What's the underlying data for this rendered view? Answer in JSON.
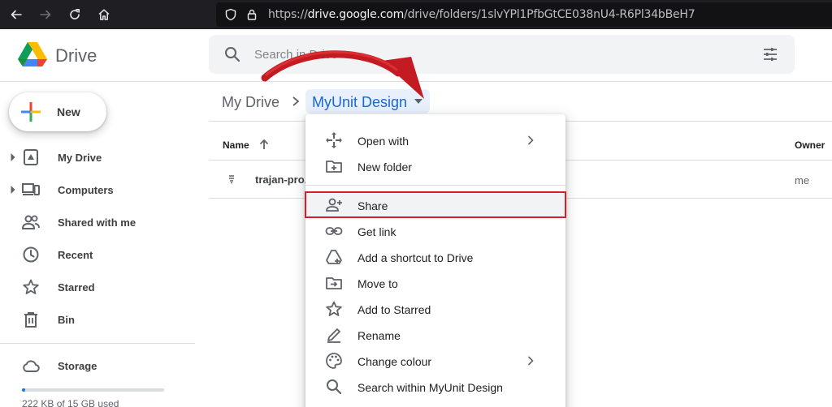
{
  "browser": {
    "url_host_prefix": "https://",
    "url_host": "drive.google.com",
    "url_path": "/drive/folders/1slvYPl1PfbGtCE038nU4-R6Pl34bBeH7"
  },
  "header": {
    "app_name": "Drive",
    "search_placeholder": "Search in Drive"
  },
  "sidebar": {
    "new_label": "New",
    "items": [
      {
        "label": "My Drive"
      },
      {
        "label": "Computers"
      },
      {
        "label": "Shared with me"
      },
      {
        "label": "Recent"
      },
      {
        "label": "Starred"
      },
      {
        "label": "Bin"
      }
    ],
    "storage_label": "Storage",
    "storage_used_text": "222 KB of 15 GB used",
    "storage_used_fraction": 0.01
  },
  "main": {
    "breadcrumb_root": "My Drive",
    "breadcrumb_current": "MyUnit Design",
    "columns": {
      "name": "Name",
      "owner": "Owner"
    },
    "files": [
      {
        "name": "trajan-pro.zip",
        "owner": "me"
      }
    ]
  },
  "context_menu": {
    "items": [
      {
        "label": "Open with"
      },
      {
        "label": "New folder"
      },
      {
        "label": "Share"
      },
      {
        "label": "Get link"
      },
      {
        "label": "Add a shortcut to Drive"
      },
      {
        "label": "Move to"
      },
      {
        "label": "Add to Starred"
      },
      {
        "label": "Rename"
      },
      {
        "label": "Change colour"
      },
      {
        "label": "Search within MyUnit Design"
      }
    ]
  },
  "colors": {
    "accent_blue": "#1a73e8",
    "highlight_red": "#d81e2a",
    "breadcrumb_bg": "#e8f0fe"
  }
}
